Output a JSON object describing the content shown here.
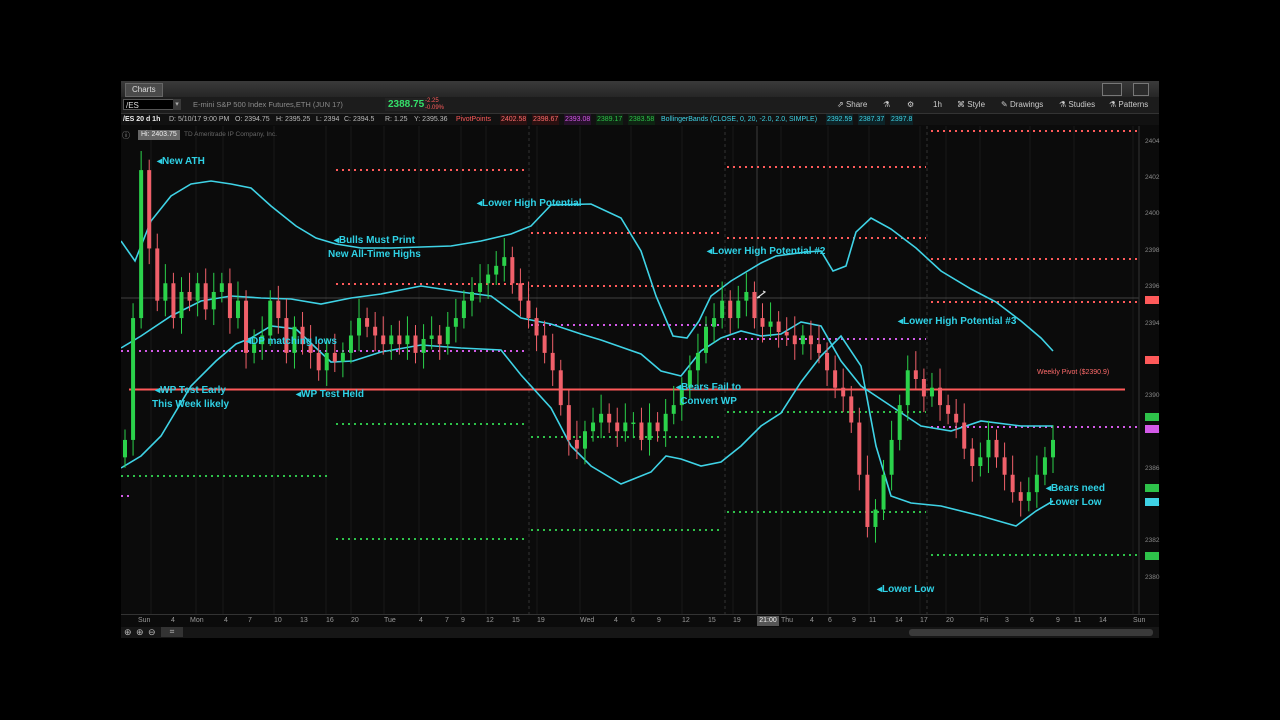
{
  "window": {
    "tab_label": "Charts",
    "symbol": "/ES",
    "instrument": "E-mini S&P 500 Index Futures,ETH (JUN 17)",
    "last_price": "2388.75",
    "change_1": "-2.25",
    "change_2": "-0.09%",
    "toolbar": {
      "share": "Share",
      "timeframe": "1h",
      "style": "Style",
      "drawings": "Drawings",
      "studies": "Studies",
      "patterns": "Patterns"
    }
  },
  "study_bar": {
    "period": "/ES 20 d 1h",
    "date": "D: 5/10/17 9:00 PM",
    "open": "O: 2394.75",
    "high": "H: 2395.25",
    "low": "L: 2394",
    "close": "C: 2394.5",
    "range": "R: 1.25",
    "y": "Y: 2395.36",
    "pivot_name": "PivotPoints",
    "pivot_values": [
      "2402.58",
      "2398.67",
      "2393.08",
      "2389.17",
      "2383.58"
    ],
    "bb_name": "BollingerBands (CLOSE, 0, 20, -2.0, 2.0, SIMPLE)",
    "bb_values": [
      "2392.59",
      "2387.37",
      "2397.8"
    ],
    "copyright": "TD Ameritrade IP Company, Inc.",
    "hi_tag": "Hi: 2403.75"
  },
  "colors": {
    "bull": "#2bd24b",
    "bear": "#f0606a",
    "band": "#3fd3e6",
    "pivot_r": "#ff5a5a",
    "pivot_p": "#d35ae8",
    "pivot_s": "#2ec24a",
    "annotation": "#2fd1e5"
  },
  "annotations": [
    {
      "id": "new-ath",
      "text": "New ATH"
    },
    {
      "id": "bulls-must-print",
      "lines": [
        "Bulls Must Print",
        "New All-Time Highs"
      ]
    },
    {
      "id": "lower-high-potential",
      "text": "Lower High Potential"
    },
    {
      "id": "lower-high-potential-2",
      "text": "Lower High Potential #2"
    },
    {
      "id": "dp-matching-lows",
      "text": "DP matching lows"
    },
    {
      "id": "wp-test-early",
      "lines": [
        "WP Test Early",
        "This Week likely"
      ]
    },
    {
      "id": "wp-test-held",
      "text": "WP Test Held"
    },
    {
      "id": "bears-fail",
      "lines": [
        "Bears Fail to",
        "Convert WP"
      ]
    },
    {
      "id": "lower-high-potential-3",
      "text": "Lower High Potential #3"
    },
    {
      "id": "bears-need-lower-low",
      "lines": [
        "Bears need",
        "Lower Low"
      ]
    },
    {
      "id": "lower-low",
      "text": "Lower Low"
    }
  ],
  "weekly_pivot_label": "Weekly Pivot ($2390.9)",
  "price_axis": [
    "2404",
    "2402",
    "2400",
    "2398",
    "2396",
    "2394",
    "2392",
    "2390",
    "2388",
    "2386",
    "2384",
    "2382",
    "2380"
  ],
  "time_axis": [
    "Sun",
    "4",
    "Mon",
    "4",
    "7",
    "10",
    "13",
    "16",
    "20",
    "Tue",
    "4",
    "7",
    "9",
    "12",
    "15",
    "19",
    "Wed",
    "4",
    "6",
    "9",
    "12",
    "15",
    "19",
    "Thu",
    "4",
    "6",
    "9",
    "11",
    "14",
    "17",
    "20",
    "Fri",
    "3",
    "6",
    "9",
    "11",
    "14",
    "Sun"
  ],
  "crosshair_time": "21:00",
  "chart_data": {
    "type": "candlestick",
    "y_unit": "price",
    "ylim": [
      2378.0,
      2405.0
    ],
    "weekly_pivot": 2390.9,
    "candles_close": [
      2388,
      2395,
      2403.5,
      2399,
      2396,
      2397,
      2395,
      2396.5,
      2396,
      2397,
      2395.5,
      2396.5,
      2397,
      2395,
      2396,
      2393,
      2393.5,
      2394,
      2396,
      2395,
      2393,
      2394.5,
      2393.5,
      2393,
      2392,
      2393,
      2392.5,
      2393,
      2394,
      2395,
      2394.5,
      2394,
      2393.5,
      2394,
      2393.5,
      2394,
      2393,
      2393.8,
      2394,
      2393.5,
      2394.5,
      2395,
      2396,
      2396.5,
      2397,
      2397.5,
      2398,
      2398.5,
      2397,
      2396,
      2395,
      2394,
      2393,
      2392,
      2390,
      2388,
      2387.5,
      2388.5,
      2389,
      2389.5,
      2389,
      2388.5,
      2389,
      2389,
      2388,
      2389,
      2388.5,
      2389.5,
      2390,
      2391,
      2392,
      2393,
      2394.5,
      2395,
      2396,
      2395,
      2396,
      2396.5,
      2395,
      2394.5,
      2394.8,
      2394.2,
      2394,
      2393.5,
      2394,
      2393.5,
      2393,
      2392,
      2391,
      2390.5,
      2389,
      2386,
      2383,
      2384,
      2386,
      2388,
      2390,
      2392,
      2391.5,
      2390.5,
      2391,
      2390,
      2389.5,
      2389,
      2387.5,
      2386.5,
      2387,
      2388,
      2387,
      2386,
      2385,
      2384.5,
      2385,
      2386,
      2387,
      2388
    ]
  }
}
